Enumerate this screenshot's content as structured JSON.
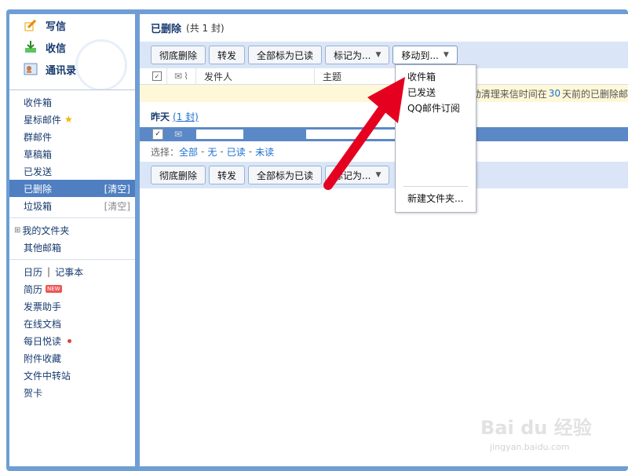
{
  "sidebar": {
    "actions": [
      {
        "label": "写信",
        "icon": "compose-icon"
      },
      {
        "label": "收信",
        "icon": "receive-icon"
      },
      {
        "label": "通讯录",
        "icon": "contacts-icon"
      }
    ],
    "folders": [
      {
        "label": "收件箱"
      },
      {
        "label": "星标邮件",
        "icon": "star-icon"
      },
      {
        "label": "群邮件"
      },
      {
        "label": "草稿箱"
      },
      {
        "label": "已发送"
      },
      {
        "label": "已删除",
        "extra": "[清空]",
        "active": true
      },
      {
        "label": "垃圾箱",
        "extra": "[清空]"
      }
    ],
    "my_folders": [
      {
        "label": "我的文件夹",
        "prefix": "⊞"
      },
      {
        "label": "其他邮箱"
      }
    ],
    "apps": [
      {
        "label": "日历",
        "sep": "|",
        "label2": "记事本"
      },
      {
        "label": "简历",
        "badge": "NEW"
      },
      {
        "label": "发票助手"
      },
      {
        "label": "在线文档"
      },
      {
        "label": "每日悦读",
        "dot": true
      },
      {
        "label": "附件收藏"
      },
      {
        "label": "文件中转站"
      },
      {
        "label": "贺卡"
      }
    ]
  },
  "content": {
    "title": "已删除",
    "count": "(共 1 封)",
    "toolbar": {
      "delete": "彻底删除",
      "forward": "转发",
      "mark_all": "全部标为已读",
      "mark_as": "标记为...",
      "move_to": "移动到..."
    },
    "headers": {
      "sender": "发件人",
      "subject": "主题"
    },
    "notice": {
      "prefix": "动清理来信时间在",
      "days": "30",
      "suffix": "天前的已删除邮"
    },
    "group": {
      "name": "昨天",
      "count": "(1 封)"
    },
    "select": {
      "label": "选择：",
      "all": "全部",
      "none": "无",
      "read": "已读",
      "unread": "未读",
      "sep": "-"
    }
  },
  "dropdown": {
    "items": [
      "收件箱",
      "已发送",
      "QQ邮件订阅"
    ],
    "new_folder": "新建文件夹..."
  },
  "watermark": {
    "brand": "Bai du 经验",
    "url": "jingyan.baidu.com"
  },
  "colors": {
    "accent": "#4f7fc1",
    "frame": "#6f9ed4",
    "annotation_arrow": "#e5001f",
    "notice_bg": "#fff8d8"
  }
}
